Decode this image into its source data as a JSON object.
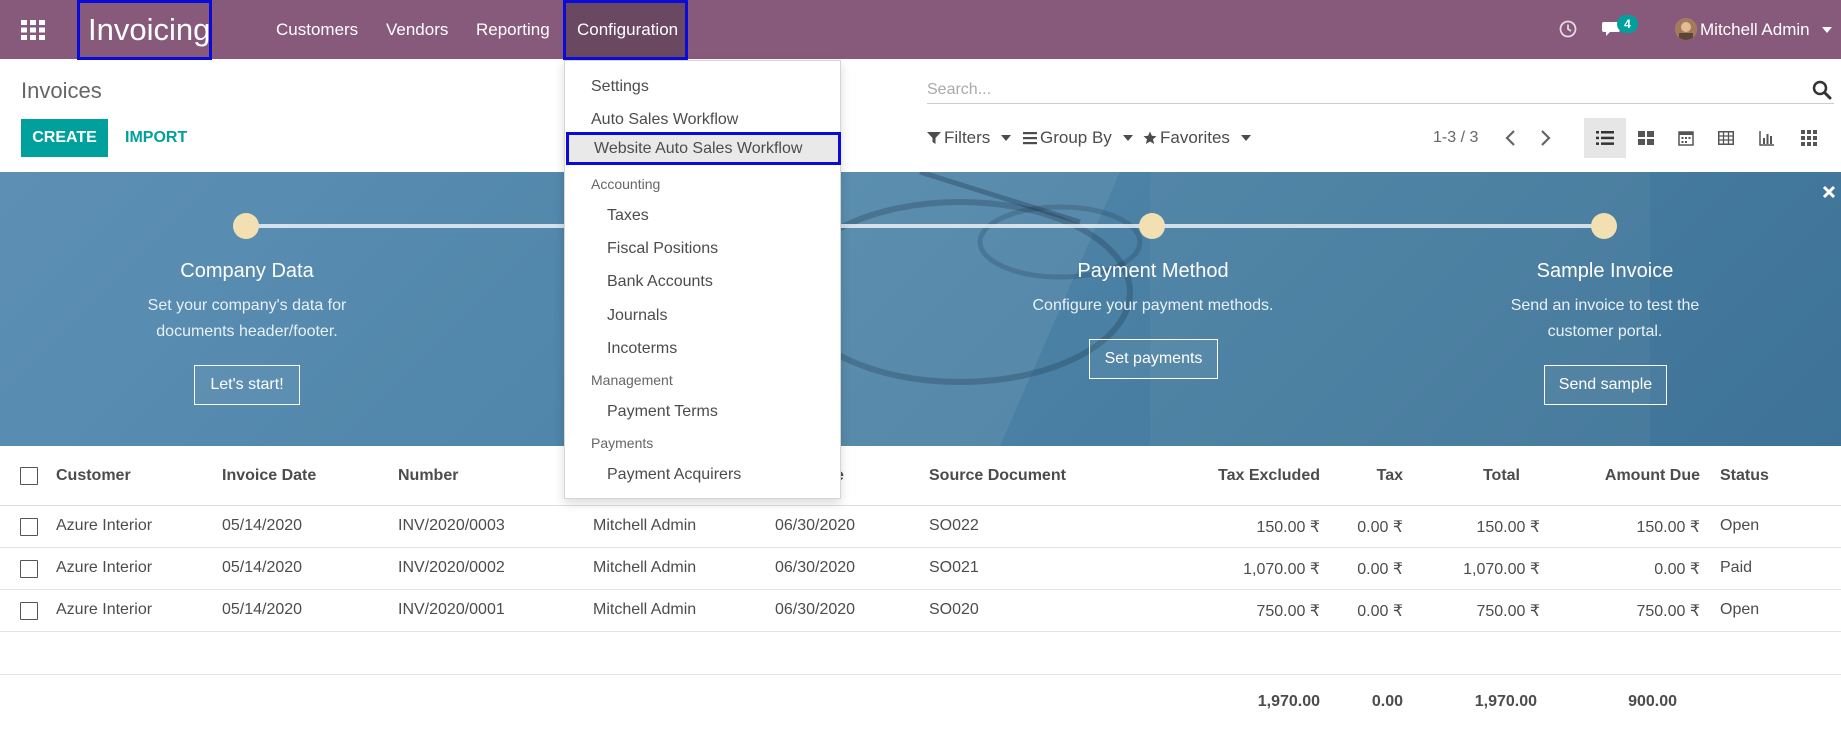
{
  "navbar": {
    "app_name": "Invoicing",
    "menu": [
      "Customers",
      "Vendors",
      "Reporting",
      "Configuration"
    ],
    "chat_count": "4",
    "user": "Mitchell Admin"
  },
  "control_panel": {
    "breadcrumb": "Invoices",
    "create_label": "CREATE",
    "import_label": "IMPORT",
    "search_placeholder": "Search...",
    "filters_label": "Filters",
    "groupby_label": "Group By",
    "favorites_label": "Favorites",
    "pager": "1-3 / 3"
  },
  "banner": {
    "steps": [
      {
        "title": "Company Data",
        "desc1": "Set your company's data for",
        "desc2": "documents header/footer.",
        "button": "Let's start!"
      },
      {
        "title": "Payment Method",
        "desc1": "Configure your payment methods.",
        "desc2": "",
        "button": "Set payments"
      },
      {
        "title": "Sample Invoice",
        "desc1": "Send an invoice to test the",
        "desc2": "customer portal.",
        "button": "Send sample"
      }
    ]
  },
  "table": {
    "headers": {
      "customer": "Customer",
      "invoice_date": "Invoice Date",
      "number": "Number",
      "due_date_partial": "e",
      "source": "Source Document",
      "tax_excluded": "Tax Excluded",
      "tax": "Tax",
      "total": "Total",
      "amount_due": "Amount Due",
      "status": "Status"
    },
    "rows": [
      {
        "customer": "Azure Interior",
        "date": "05/14/2020",
        "number": "INV/2020/0003",
        "salesperson": "Mitchell Admin",
        "due": "06/30/2020",
        "source": "SO022",
        "tax_excluded": "150.00 ₹",
        "tax": "0.00 ₹",
        "total": "150.00 ₹",
        "amount_due": "150.00 ₹",
        "status": "Open"
      },
      {
        "customer": "Azure Interior",
        "date": "05/14/2020",
        "number": "INV/2020/0002",
        "salesperson": "Mitchell Admin",
        "due": "06/30/2020",
        "source": "SO021",
        "tax_excluded": "1,070.00 ₹",
        "tax": "0.00 ₹",
        "total": "1,070.00 ₹",
        "amount_due": "0.00 ₹",
        "status": "Paid"
      },
      {
        "customer": "Azure Interior",
        "date": "05/14/2020",
        "number": "INV/2020/0001",
        "salesperson": "Mitchell Admin",
        "due": "06/30/2020",
        "source": "SO020",
        "tax_excluded": "750.00 ₹",
        "tax": "0.00 ₹",
        "total": "750.00 ₹",
        "amount_due": "750.00 ₹",
        "status": "Open"
      }
    ],
    "totals": {
      "tax_excluded": "1,970.00",
      "tax": "0.00",
      "total": "1,970.00",
      "amount_due": "900.00"
    }
  },
  "dropdown": {
    "settings": "Settings",
    "auto_sales": "Auto Sales Workflow",
    "website_auto_sales": "Website Auto Sales Workflow",
    "accounting_header": "Accounting",
    "taxes": "Taxes",
    "fiscal_positions": "Fiscal Positions",
    "bank_accounts": "Bank Accounts",
    "journals": "Journals",
    "incoterms": "Incoterms",
    "management_header": "Management",
    "payment_terms": "Payment Terms",
    "payments_header": "Payments",
    "payment_acquirers": "Payment Acquirers"
  },
  "colors": {
    "navbar": "#875a7b",
    "accent": "#00a09d",
    "highlight_border": "#0b0bd9",
    "banner": "#4f86a9"
  }
}
